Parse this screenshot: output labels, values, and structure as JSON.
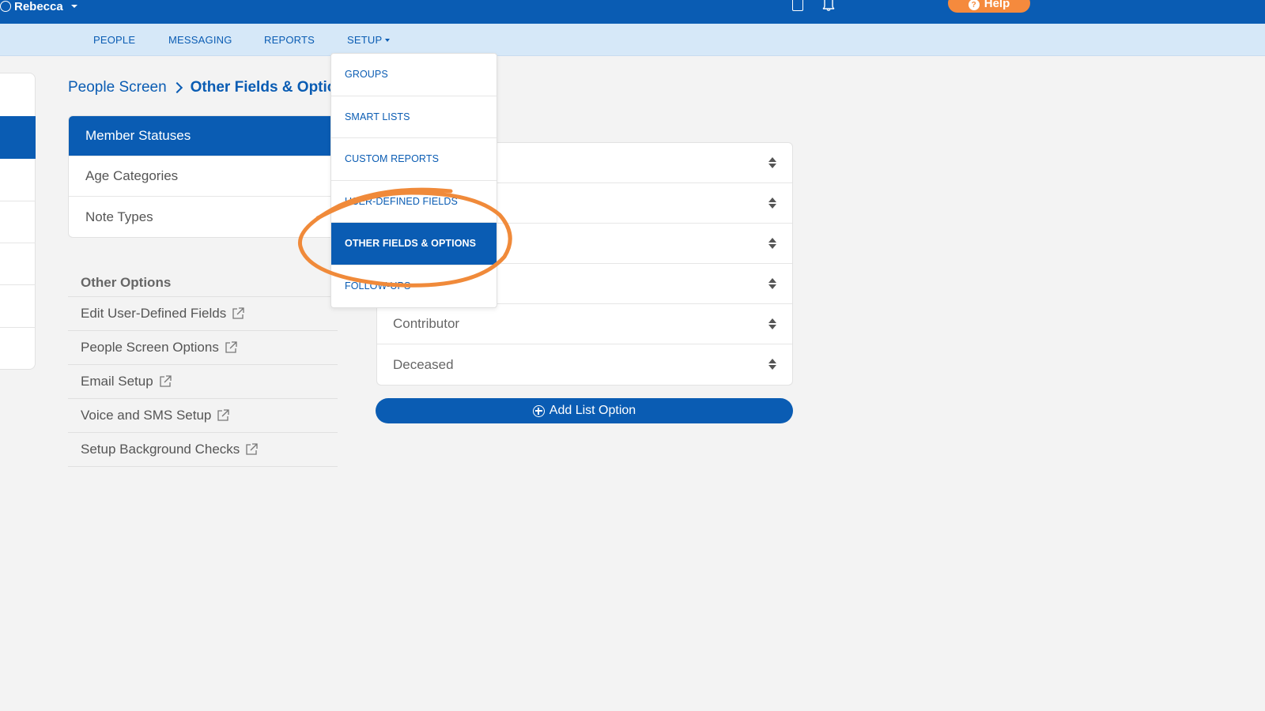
{
  "topbar": {
    "user_name": "Rebecca",
    "help_label": "Help",
    "brand_color": "#0a5cb3",
    "help_color": "#f58a3d"
  },
  "nav": {
    "items": [
      "PEOPLE",
      "MESSAGING",
      "REPORTS",
      "SETUP"
    ]
  },
  "breadcrumb": {
    "parent": "People Screen",
    "current": "Other Fields & Options"
  },
  "categories": [
    "Member Statuses",
    "Age Categories",
    "Note Types"
  ],
  "other_options": {
    "title": "Other Options",
    "items": [
      "Edit User-Defined Fields",
      "People Screen Options",
      "Email Setup",
      "Voice and SMS Setup",
      "Setup Background Checks"
    ]
  },
  "list_options": [
    "",
    "",
    "",
    "",
    "Contributor",
    "Deceased"
  ],
  "add_button_label": "Add List Option",
  "setup_menu": {
    "items": [
      "GROUPS",
      "SMART LISTS",
      "CUSTOM REPORTS",
      "USER-DEFINED FIELDS",
      "OTHER FIELDS & OPTIONS",
      "FOLLOW-UPS"
    ],
    "active": "OTHER FIELDS & OPTIONS"
  },
  "annotation_color": "#f08a3a"
}
